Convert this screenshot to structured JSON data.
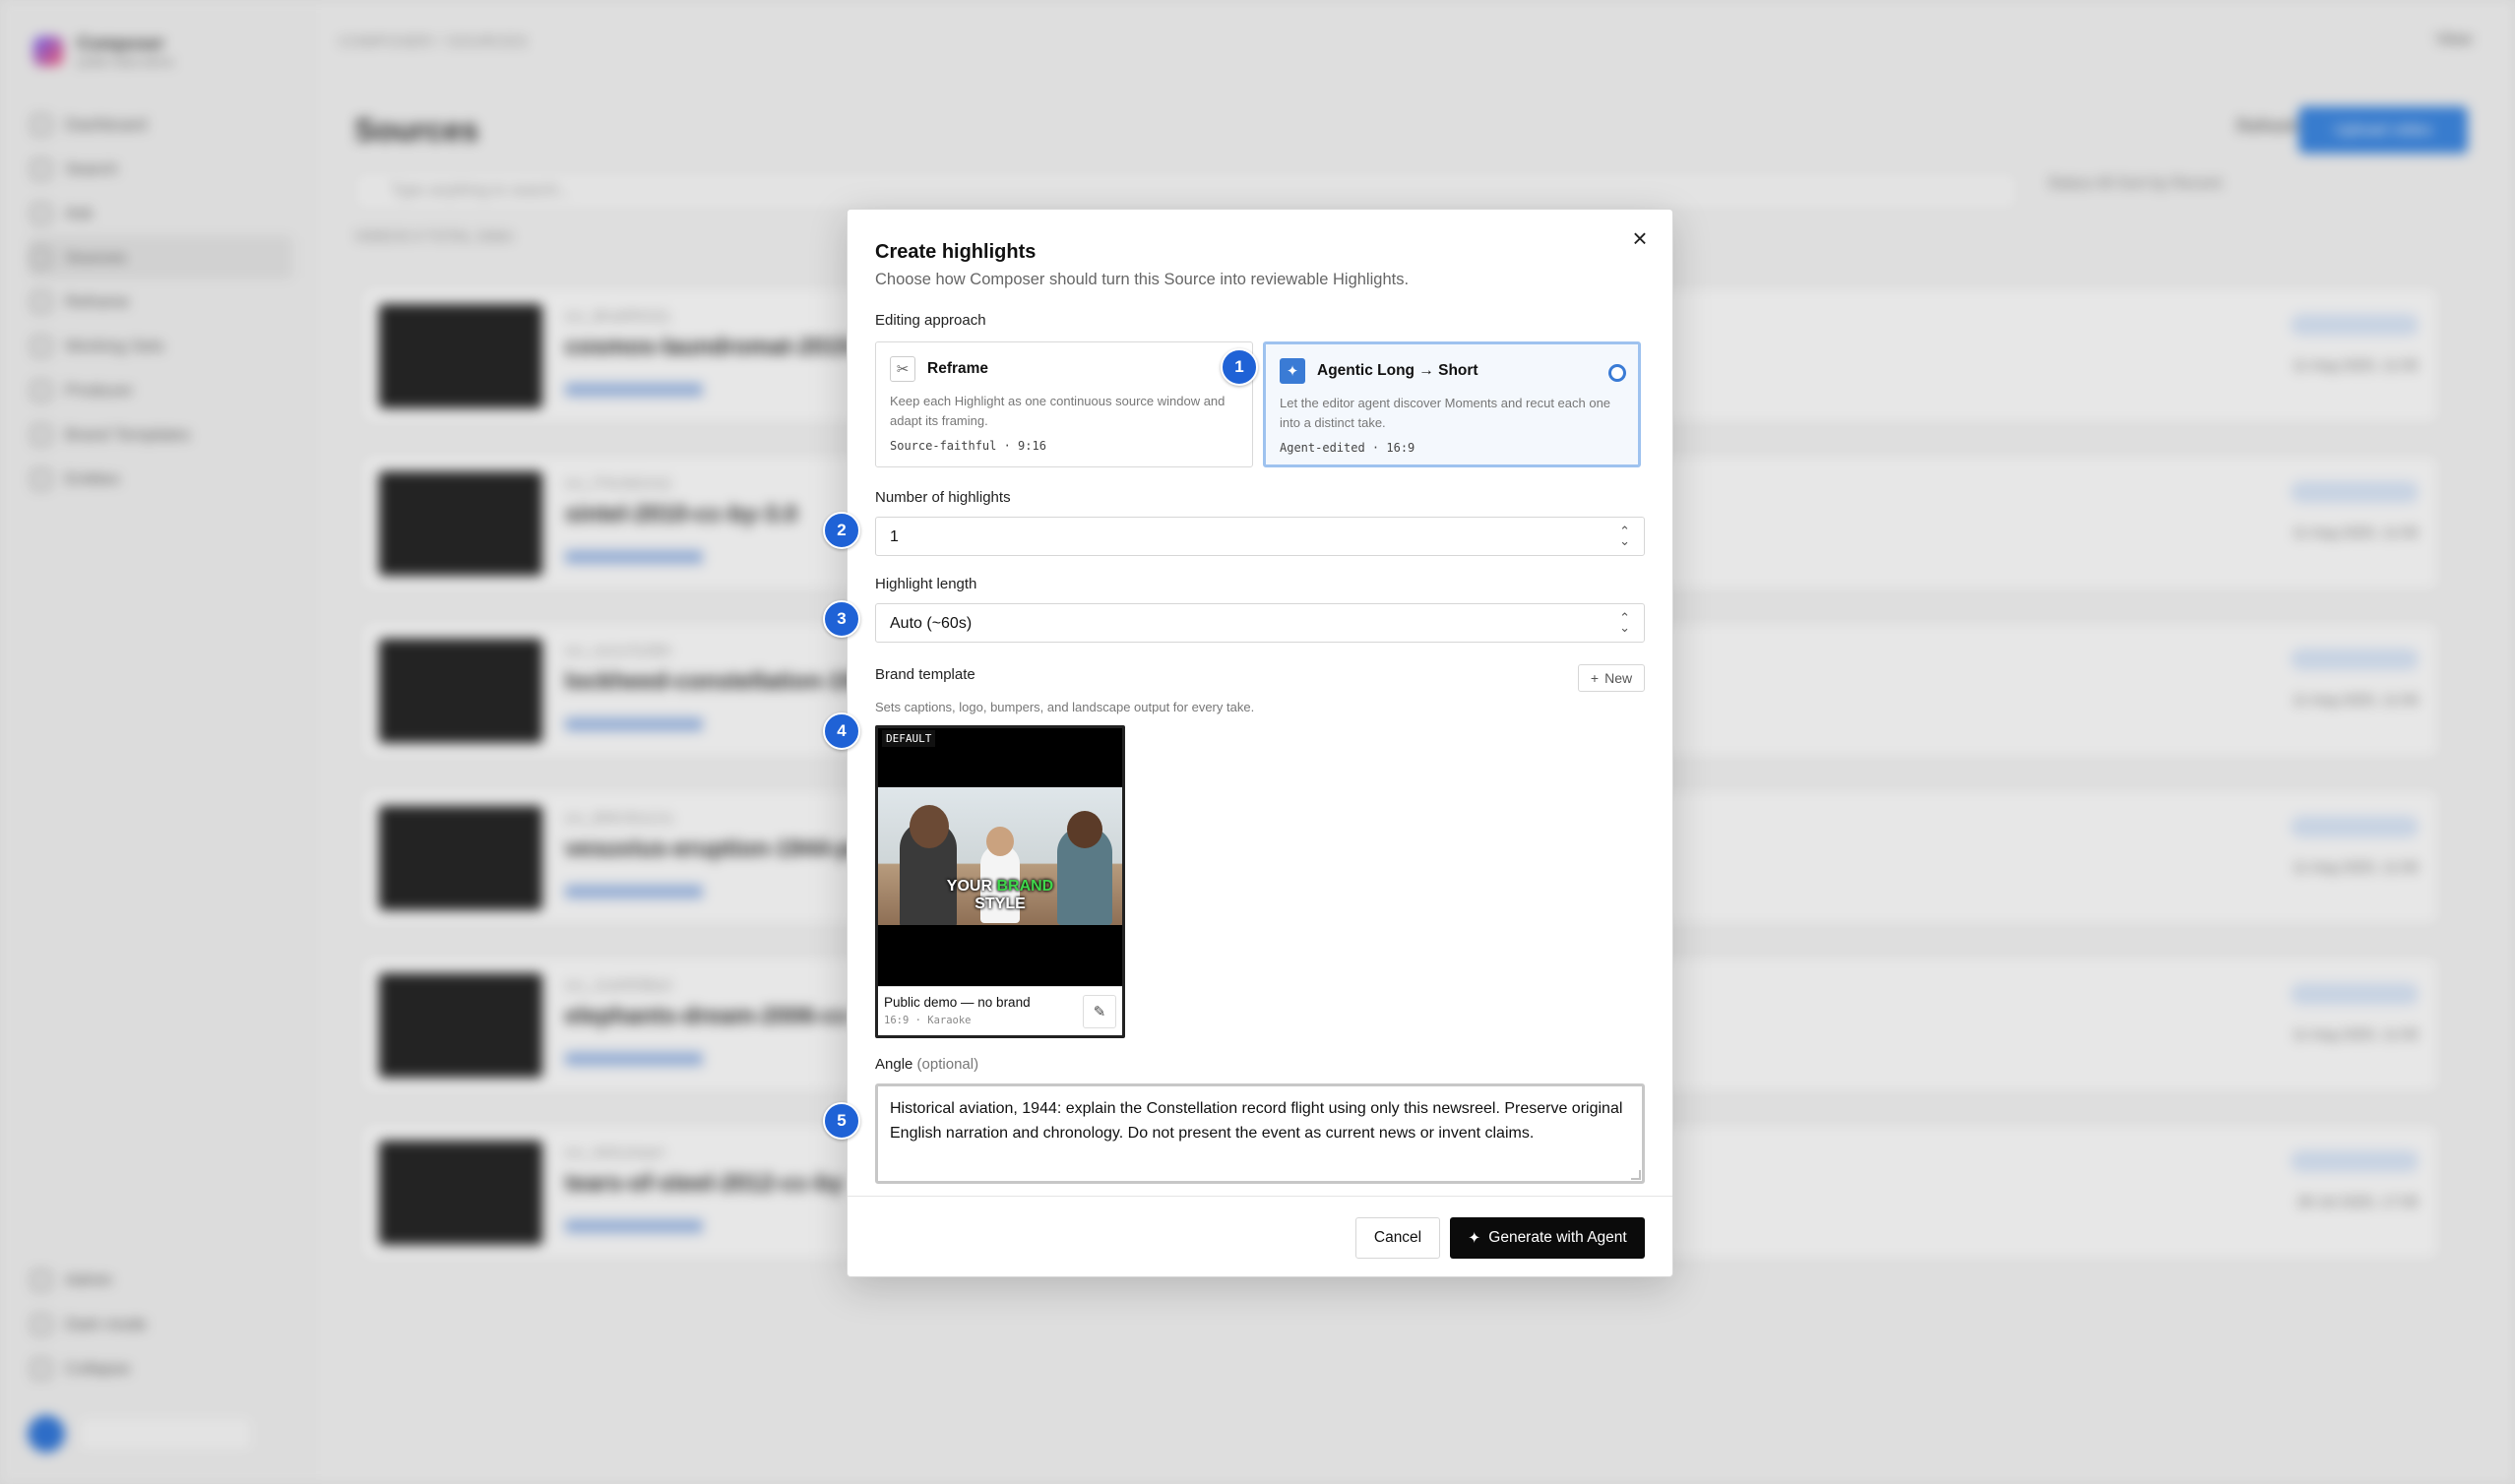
{
  "app": {
    "brand_title": "Composer",
    "brand_sub": "public beta demo",
    "breadcrumb": "COMPOSER  /  SOURCES",
    "view_label": "View",
    "page_title": "Sources",
    "refresh_label": "Refresh",
    "upload_label": "Upload video",
    "search_placeholder": "Type anything to search...",
    "filters_text": "Status  All      Sort by  Recent",
    "counts_text": "VIDEOS  6      TOTAL  1h6m",
    "nav": [
      "Dashboard",
      "Search",
      "Ask",
      "Sources",
      "Reframe",
      "Working Sets",
      "Producer",
      "Brand Templates",
      "Entities"
    ],
    "nav_bottom": [
      "Admin",
      "Dark mode",
      "Collapse"
    ],
    "cards": [
      {
        "id": "src_8Ka6RhS2L",
        "title": "cosmos-laundromat-2015-cc-by",
        "date": "11 Aug 2025, 11:55"
      },
      {
        "id": "src_f7Nc9k2mQ",
        "title": "sintel-2010-cc-by-3.0",
        "date": "11 Aug 2025, 11:55"
      },
      {
        "id": "src_noUuTsZ8N",
        "title": "lockheed-constellation-1944",
        "date": "11 Aug 2025, 11:50"
      },
      {
        "id": "src_B9KHKsLVu",
        "title": "vesuvius-eruption-1944-pd",
        "date": "11 Aug 2025, 11:50"
      },
      {
        "id": "src_JcwhR9Ba4",
        "title": "elephants-dream-2006-cc-by",
        "date": "11 Aug 2025, 11:55"
      },
      {
        "id": "src_Wd1uhaeri",
        "title": "tears-of-steel-2012-cc-by",
        "date": "28 Jul 2025, 17:05"
      }
    ]
  },
  "modal": {
    "title": "Create highlights",
    "subtitle": "Choose how Composer should turn this Source into reviewable Highlights.",
    "editing_approach_label": "Editing approach",
    "approaches": [
      {
        "title": "Reframe",
        "desc": "Keep each Highlight as one continuous source window and adapt its framing.",
        "meta": "Source-faithful · 9:16"
      },
      {
        "title": "Agentic Long → Short",
        "desc": "Let the editor agent discover Moments and recut each one into a distinct take.",
        "meta": "Agent-edited · 16:9"
      }
    ],
    "num_highlights_label": "Number of highlights",
    "num_highlights_value": "1",
    "length_label": "Highlight length",
    "length_value": "Auto (~60s)",
    "brand_label": "Brand template",
    "new_label": "New",
    "brand_hint": "Sets captions, logo, bumpers, and landscape output for every take.",
    "template": {
      "badge": "DEFAULT",
      "caption_1": "YOUR",
      "caption_accent": "BRAND",
      "caption_2": "STYLE",
      "name": "Public demo — no brand",
      "meta": "16:9 · Karaoke"
    },
    "angle_label": "Angle",
    "angle_optional": "(optional)",
    "angle_value": "Historical aviation, 1944: explain the Constellation record flight using only this newsreel. Preserve original English narration and chronology. Do not present the event as current news or invent claims.",
    "cancel_label": "Cancel",
    "generate_label": "Generate with Agent"
  },
  "steps": [
    "1",
    "2",
    "3",
    "4",
    "5"
  ],
  "colors": {
    "accent": "#1f62d6",
    "primary_button": "#0b0b0b",
    "selected_border": "#9ec2ef",
    "brand_green": "#3fd64b"
  },
  "icons": {
    "close": "close-icon",
    "reframe": "scissors-icon",
    "agentic": "sparkles-icon",
    "stepper": "chevron-updown-icon",
    "new": "plus-icon",
    "edit": "pencil-icon"
  }
}
